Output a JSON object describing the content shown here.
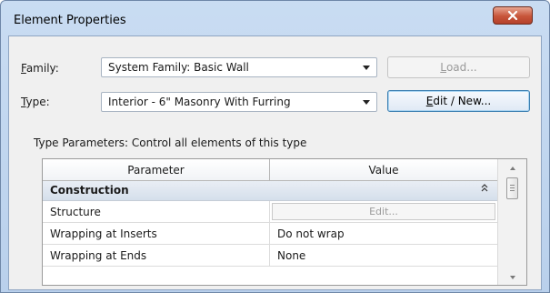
{
  "window": {
    "title": "Element Properties",
    "close_glyph": "x"
  },
  "family": {
    "label": "Family:",
    "label_mnemonic": "F",
    "label_rest": "amily:",
    "value": "System Family: Basic Wall"
  },
  "type": {
    "label": "Type:",
    "label_mnemonic": "T",
    "label_rest": "ype:",
    "value": "Interior - 6\" Masonry With Furring"
  },
  "buttons": {
    "load": {
      "pre": "",
      "mnemonic": "L",
      "post": "oad...",
      "enabled": false
    },
    "edit_new": {
      "pre": "",
      "mnemonic": "E",
      "post": "dit / New...",
      "enabled": true
    }
  },
  "type_parameters_caption": "Type Parameters: Control all elements of this type",
  "grid": {
    "headers": {
      "parameter": "Parameter",
      "value": "Value"
    },
    "group": {
      "name": "Construction",
      "collapse_glyph": "⌃"
    },
    "rows": [
      {
        "parameter": "Structure",
        "value": "Edit...",
        "value_is_button": true
      },
      {
        "parameter": "Wrapping at Inserts",
        "value": "Do not wrap"
      },
      {
        "parameter": "Wrapping at Ends",
        "value": "None"
      }
    ]
  },
  "colors": {
    "title_bar": "#c9dcf2",
    "close_red": "#c7553a",
    "group_header": "#d5dfeb"
  },
  "icons": [
    "close-icon",
    "dropdown-arrow-icon",
    "collapse-chevrons-icon",
    "scroll-up-icon",
    "scroll-down-icon",
    "scroll-thumb-grip-icon"
  ]
}
